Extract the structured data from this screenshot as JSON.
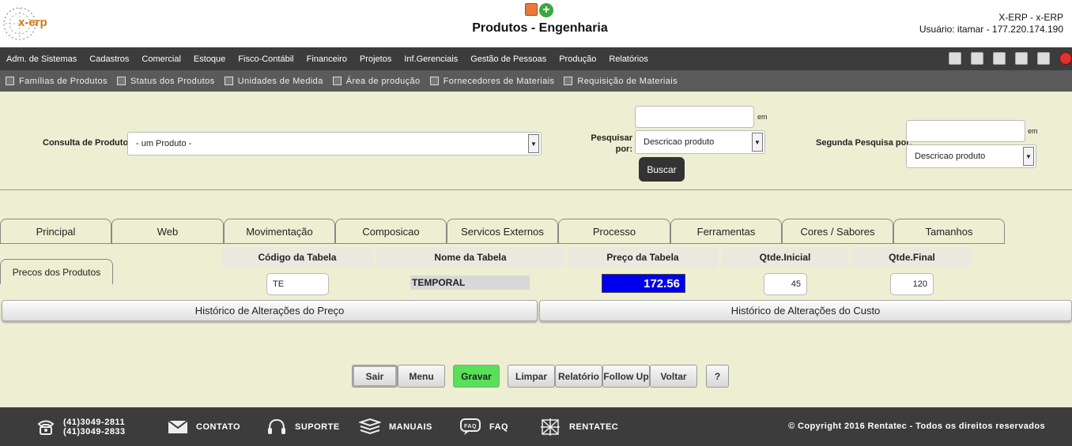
{
  "header": {
    "logo_text": "x-erp",
    "title": "Produtos - Engenharia",
    "user_line1": "X-ERP - x-ERP",
    "user_line2": "Usuário: itamar - 177.220.174.190",
    "icons": [
      "document-icon",
      "add-icon"
    ]
  },
  "menu": {
    "items": [
      "Adm. de Sistemas",
      "Cadastros",
      "Comercial",
      "Estoque",
      "Fisco-Contábil",
      "Financeiro",
      "Projetos",
      "Inf.Gerenciais",
      "Gestão de Pessoas",
      "Produção",
      "Relatórios"
    ],
    "icons": [
      "home-icon",
      "print-icon",
      "page-icon",
      "list-icon",
      "globe-icon",
      "exit-icon"
    ]
  },
  "submenu": {
    "items": [
      "Famílias de Produtos",
      "Status dos Produtos",
      "Unidades de Medida",
      "Área de produção",
      "Fornecedores de Materiais",
      "Requisição de Materiais"
    ]
  },
  "search": {
    "consulta_label": "Consulta de Produtos",
    "consulta_value": "- um Produto -",
    "pesquisar_label": "Pesquisar por:",
    "pesquisar_value": "Descricao produto",
    "pesquisar_em": "em",
    "buscar": "Buscar",
    "segunda_label": "Segunda Pesquisa por:",
    "segunda_value": "Descricao produto",
    "segunda_em": "em"
  },
  "tabs": [
    "Principal",
    "Web",
    "Movimentação",
    "Composicao",
    "Servicos Externos",
    "Processo",
    "Ferramentas",
    "Cores / Sabores",
    "Tamanhos"
  ],
  "side_tab": "Precos dos Produtos",
  "price_table": {
    "headers": [
      "Código da Tabela",
      "Nome da Tabela",
      "Preço da Tabela",
      "Qtde.Inicial",
      "Qtde.Final"
    ],
    "codigo": "TE",
    "nome": "TEMPORAL",
    "preco": "172.56",
    "qtde_inicial": "45",
    "qtde_final": "120"
  },
  "history": {
    "preco": "Histórico de Alterações do Preço",
    "custo": "Histórico de Alterações do Custo"
  },
  "actions": [
    "Sair",
    "Menu",
    "Gravar",
    "Limpar",
    "Relatório",
    "Follow Up",
    "Voltar",
    "?"
  ],
  "footer": {
    "phone1": "(41)3049-2811",
    "phone2": "(41)3049-2833",
    "contato": "CONTATO",
    "suporte": "SUPORTE",
    "manuais": "MANUAIS",
    "faq": "FAQ",
    "rentatec": "RENTATEC",
    "copyright": "© Copyright 2016 Rentatec - Todos os direitos reservados"
  }
}
